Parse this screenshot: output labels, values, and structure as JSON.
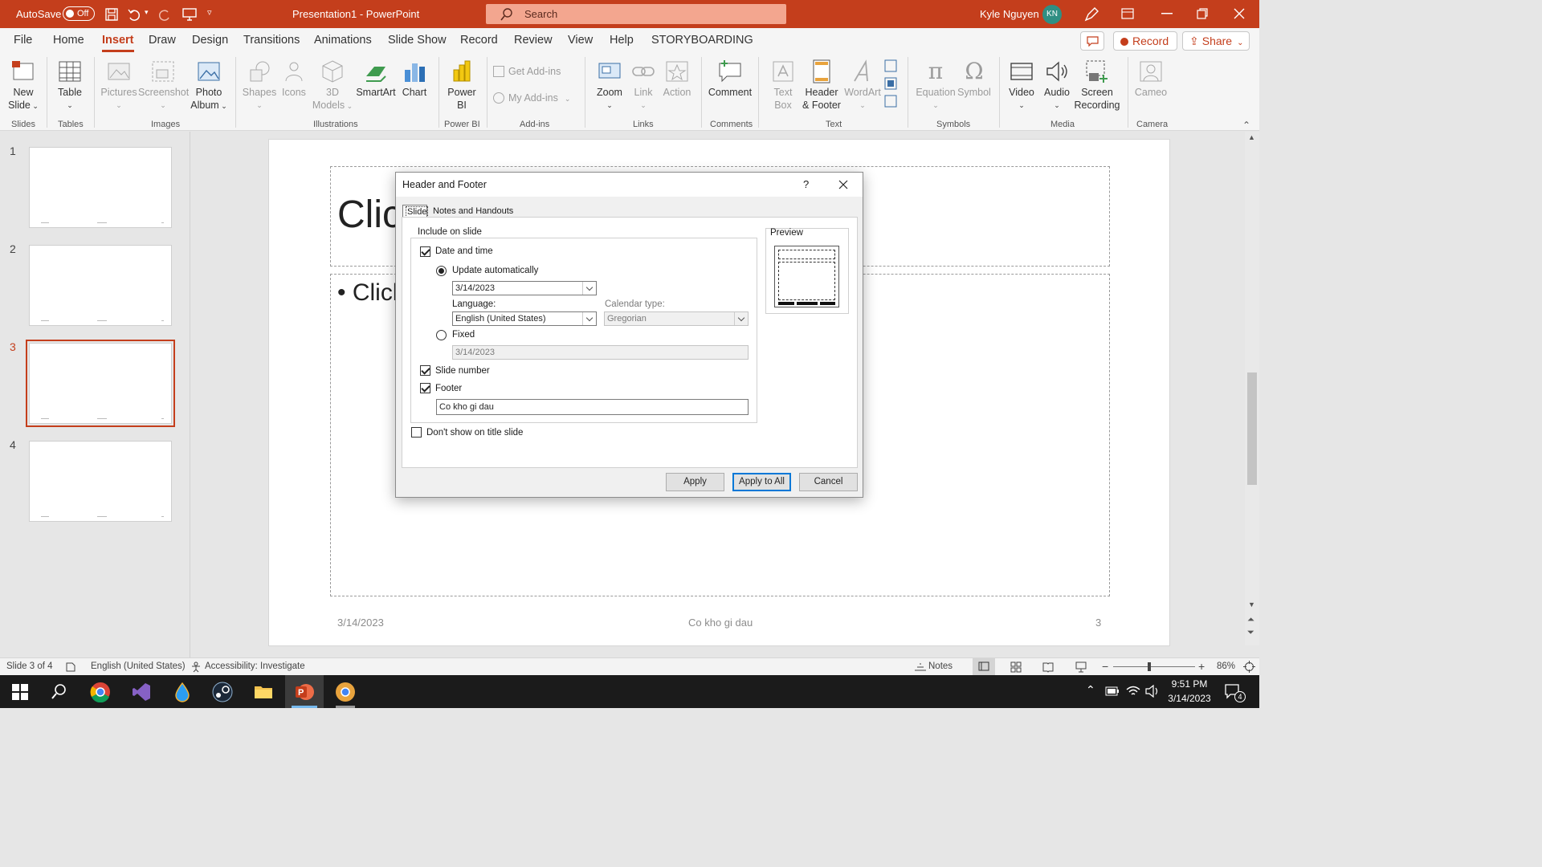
{
  "titlebar": {
    "autosave_label": "AutoSave",
    "autosave_state": "Off",
    "doc_title": "Presentation1  -  PowerPoint",
    "search_placeholder": "Search",
    "user_name": "Kyle Nguyen",
    "user_initials": "KN"
  },
  "menu": {
    "tabs": [
      "File",
      "Home",
      "Insert",
      "Draw",
      "Design",
      "Transitions",
      "Animations",
      "Slide Show",
      "Record",
      "Review",
      "View",
      "Help",
      "STORYBOARDING"
    ],
    "active_tab": "Insert",
    "record_button": "Record",
    "share_button": "Share"
  },
  "ribbon": {
    "buttons": {
      "new_slide": "New\nSlide",
      "table": "Table",
      "pictures": "Pictures",
      "screenshot": "Screenshot",
      "photo_album": "Photo\nAlbum",
      "shapes": "Shapes",
      "icons": "Icons",
      "models": "3D\nModels",
      "smartart": "SmartArt",
      "chart": "Chart",
      "power_bi": "Power\nBI",
      "get_addins": "Get Add-ins",
      "my_addins": "My Add-ins",
      "zoom": "Zoom",
      "link": "Link",
      "action": "Action",
      "comment": "Comment",
      "text_box": "Text\nBox",
      "header_footer": "Header\n& Footer",
      "wordart": "WordArt",
      "equation": "Equation",
      "symbol": "Symbol",
      "video": "Video",
      "audio": "Audio",
      "screen_recording": "Screen\nRecording",
      "cameo": "Cameo"
    },
    "groups": {
      "slides": "Slides",
      "tables": "Tables",
      "images": "Images",
      "illustrations": "Illustrations",
      "power_bi": "Power BI",
      "addins": "Add-ins",
      "links": "Links",
      "comments": "Comments",
      "text": "Text",
      "symbols": "Symbols",
      "media": "Media",
      "camera": "Camera"
    }
  },
  "thumbnails": {
    "numbers": [
      "1",
      "2",
      "3",
      "4"
    ],
    "selected": "3"
  },
  "slide": {
    "title_partial": "Clic",
    "bullet_partial": "• Clicl",
    "footer_date": "3/14/2023",
    "footer_text": "Co kho gi dau",
    "footer_number": "3"
  },
  "dialog": {
    "title": "Header and Footer",
    "help": "?",
    "tabs": [
      "Slide",
      "Notes and Handouts"
    ],
    "group_label": "Include on slide",
    "date_time_label": "Date and time",
    "update_auto_label": "Update automatically",
    "date_value": "3/14/2023",
    "language_label": "Language:",
    "language_value": "English (United States)",
    "calendar_label": "Calendar type:",
    "calendar_value": "Gregorian",
    "fixed_label": "Fixed",
    "fixed_value": "3/14/2023",
    "slide_number_label": "Slide number",
    "footer_label": "Footer",
    "footer_value": "Co kho gi dau",
    "dont_show_label": "Don't show on title slide",
    "preview_label": "Preview",
    "apply_button": "Apply",
    "apply_all_button": "Apply to All",
    "cancel_button": "Cancel"
  },
  "statusbar": {
    "slide_info": "Slide 3 of 4",
    "language": "English (United States)",
    "accessibility": "Accessibility: Investigate",
    "notes": "Notes",
    "zoom": "86%"
  },
  "taskbar": {
    "time": "9:51 PM",
    "date": "3/14/2023",
    "notification_count": "4"
  },
  "colors": {
    "accent": "#c43e1c",
    "dialog_bg": "#f0f0f0",
    "taskbar": "#1b1b1b"
  }
}
